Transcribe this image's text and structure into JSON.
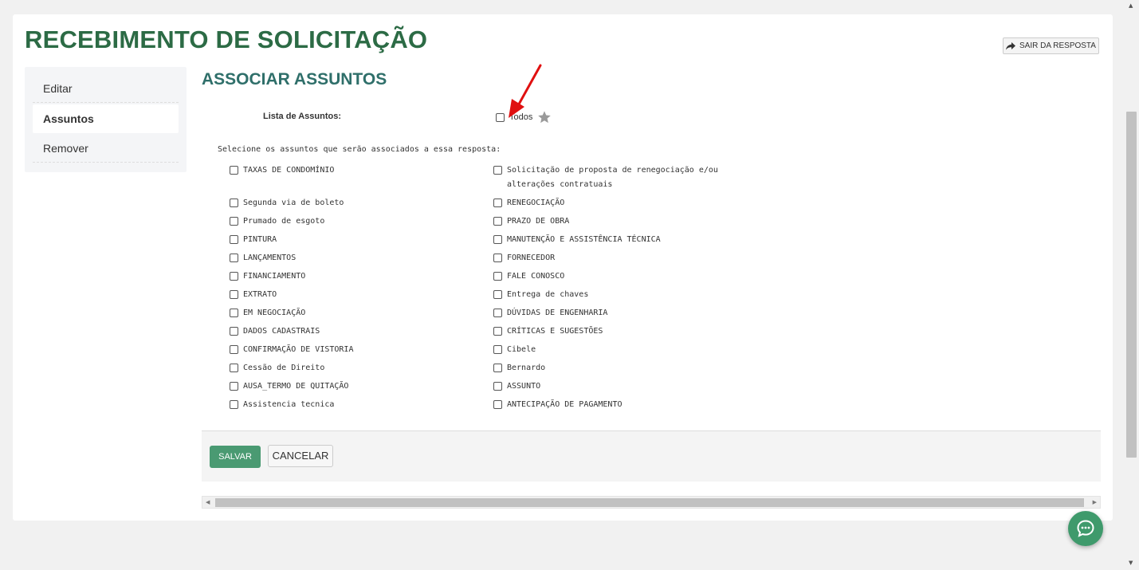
{
  "header": {
    "title": "RECEBIMENTO DE SOLICITAÇÃO",
    "exit_label": "SAIR DA RESPOSTA"
  },
  "sidebar": {
    "items": [
      {
        "label": "Editar",
        "active": false
      },
      {
        "label": "Assuntos",
        "active": true
      },
      {
        "label": "Remover",
        "active": false
      }
    ]
  },
  "main": {
    "section_title": "ASSOCIAR ASSUNTOS",
    "list_label": "Lista de Assuntos:",
    "all_label": "Todos",
    "instructions": "Selecione os assuntos que serão associados a essa resposta:",
    "subjects_left": [
      "TAXAS DE CONDOMÍNIO",
      "Segunda via de boleto",
      "Prumado de esgoto",
      "PINTURA",
      "LANÇAMENTOS",
      "FINANCIAMENTO",
      "EXTRATO",
      "EM NEGOCIAÇÃO",
      "DADOS CADASTRAIS",
      "CONFIRMAÇÃO DE VISTORIA",
      "Cessão de Direito",
      "AUSA_TERMO DE QUITAÇÃO",
      "Assistencia tecnica"
    ],
    "subjects_right": [
      "Solicitação de proposta de renegociação e/ou alterações contratuais",
      "RENEGOCIAÇÃO",
      "PRAZO DE OBRA",
      "MANUTENÇÃO E ASSISTÊNCIA TÉCNICA",
      "FORNECEDOR",
      "FALE CONOSCO",
      "Entrega de chaves",
      "DÚVIDAS DE ENGENHARIA",
      "CRÍTICAS E SUGESTÕES",
      "Cibele",
      "Bernardo",
      "ASSUNTO",
      "ANTECIPAÇÃO DE PAGAMENTO"
    ]
  },
  "footer": {
    "save_label": "SALVAR",
    "cancel_label": "CANCELAR"
  },
  "colors": {
    "title_green": "#2c6b45",
    "section_teal": "#2f6f6a",
    "save_green": "#4a9a72",
    "annotation_red": "#e01010",
    "chat_green": "#3f9a6c"
  },
  "icons": {
    "exit": "share-arrow-icon",
    "favorite": "star-icon",
    "annotation": "red-arrow-icon",
    "chat": "chat-bubble-icon"
  }
}
